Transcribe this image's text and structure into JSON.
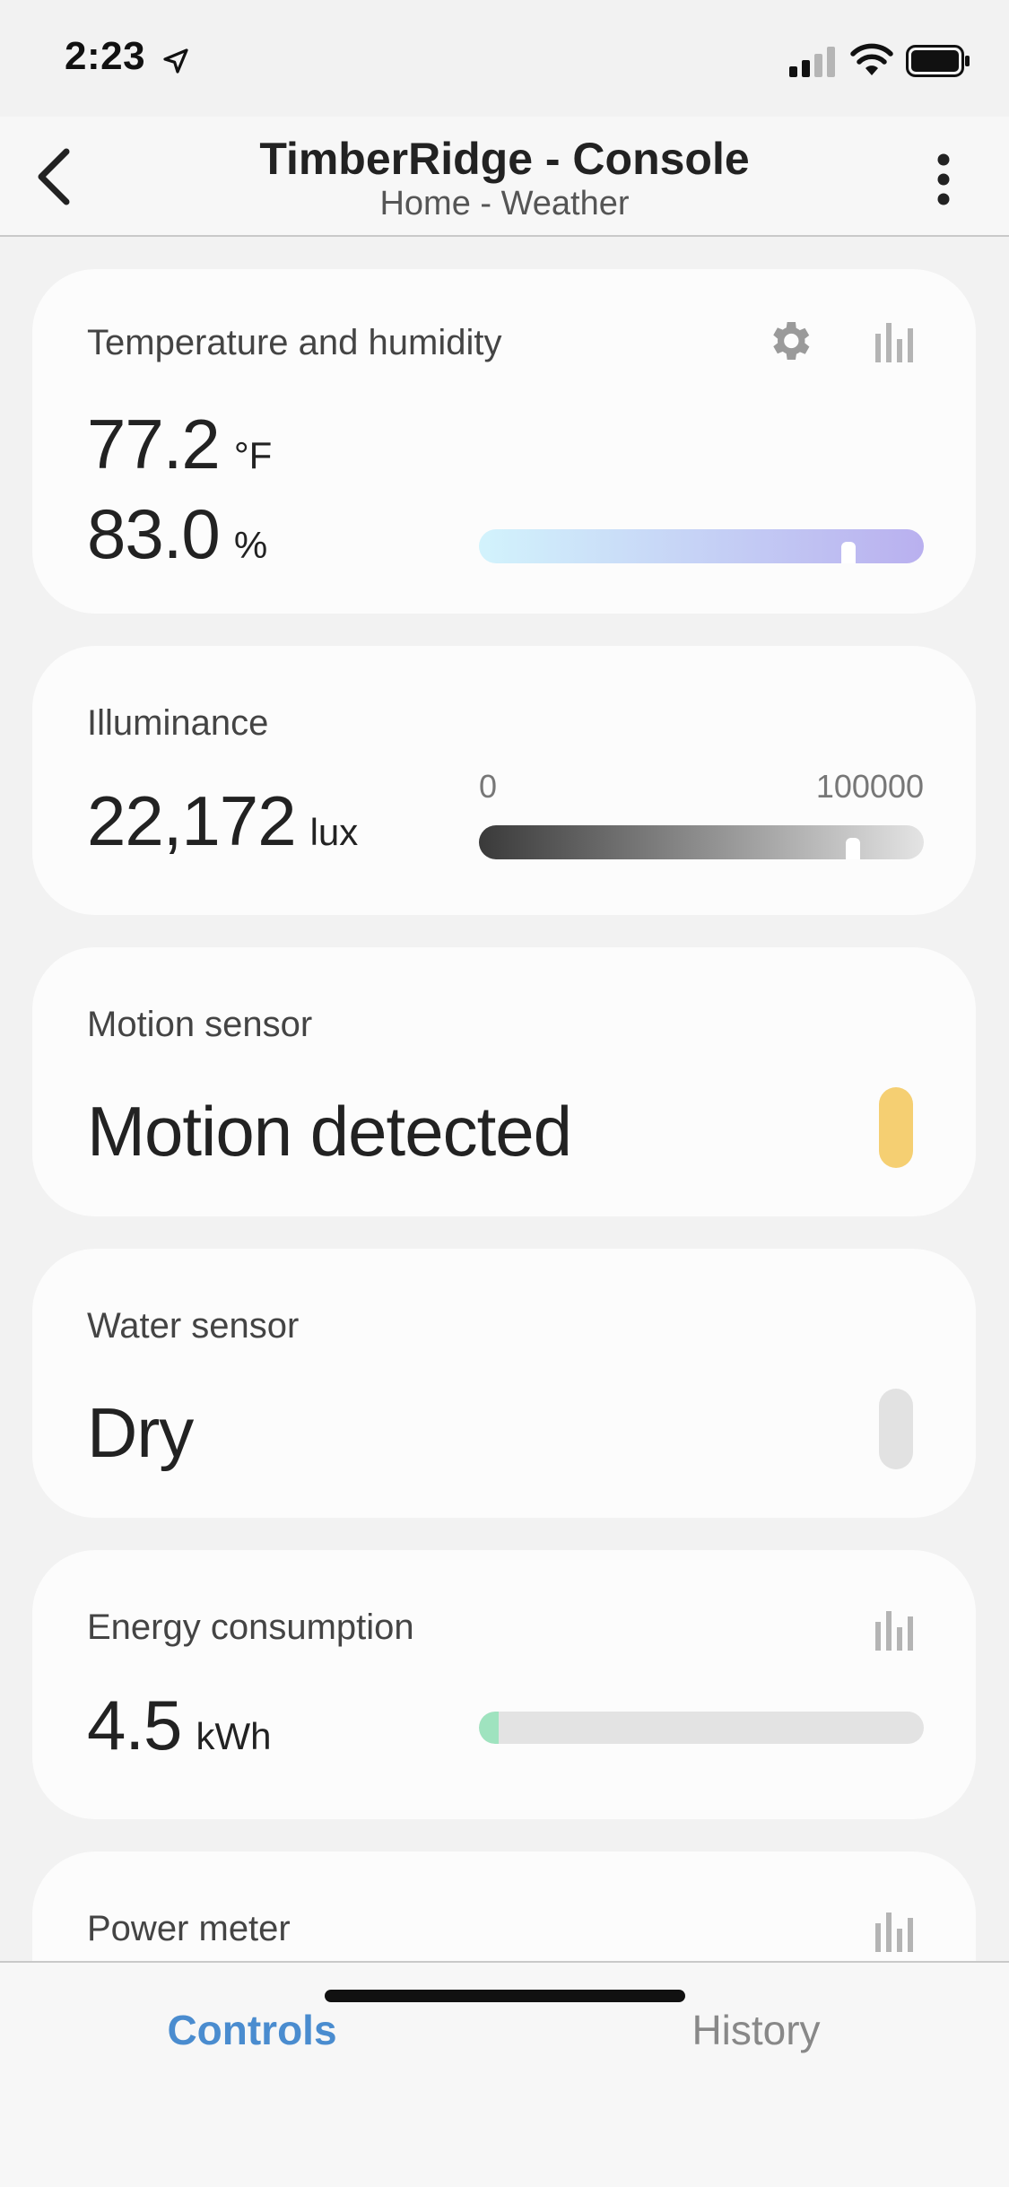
{
  "status_bar": {
    "time": "2:23"
  },
  "header": {
    "title": "TimberRidge - Console",
    "subtitle": "Home - Weather"
  },
  "cards": {
    "temp_humidity": {
      "title": "Temperature and humidity",
      "temperature": "77.2",
      "temperature_unit": "°F",
      "humidity": "83.0",
      "humidity_unit": "%",
      "humidity_level": 0.83
    },
    "illuminance": {
      "title": "Illuminance",
      "value": "22,172",
      "unit": "lux",
      "scale_min": "0",
      "scale_max": "100000",
      "level": 0.84
    },
    "motion": {
      "title": "Motion sensor",
      "state": "Motion detected",
      "indicator_color": "#f5cf72"
    },
    "water": {
      "title": "Water sensor",
      "state": "Dry",
      "indicator_color": "#e2e2e2"
    },
    "energy": {
      "title": "Energy consumption",
      "value": "4.5",
      "unit": "kWh",
      "level": 0.045
    },
    "power": {
      "title": "Power meter"
    }
  },
  "tabs": {
    "controls": "Controls",
    "history": "History"
  },
  "colors": {
    "accent": "#4a8ccf",
    "humidity_gradient_start": "#d2f3fc",
    "humidity_gradient_end": "#b9b0ef",
    "energy_fill": "#9fe3bf"
  }
}
